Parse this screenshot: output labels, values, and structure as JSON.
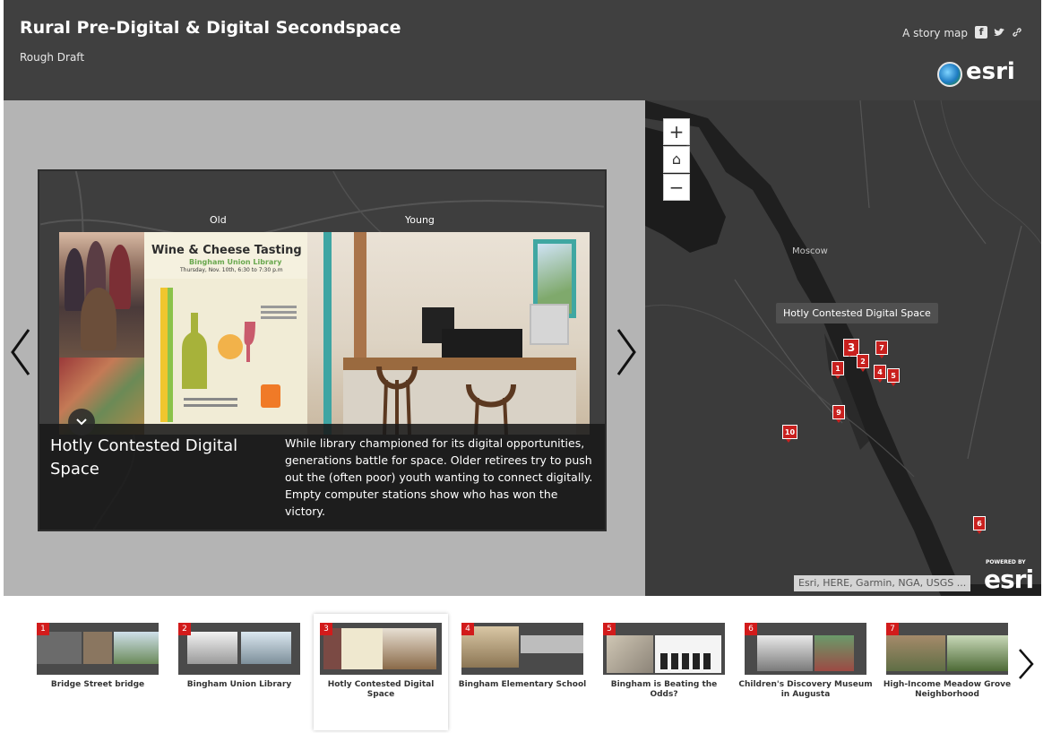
{
  "header": {
    "title": "Rural Pre-Digital & Digital Secondspace",
    "subtitle": "Rough Draft",
    "story_label": "A story map",
    "share_icons": [
      "facebook-icon",
      "twitter-icon",
      "link-icon"
    ],
    "logo_text": "esri",
    "background": "#404040"
  },
  "media": {
    "labels": {
      "old": "Old",
      "young": "Young"
    },
    "poster": {
      "title": "Wine & Cheese Tasting",
      "subtitle": "Bingham Union Library",
      "date": "Thursday, Nov. 10th, 6:30 to 7:30 p.m"
    },
    "caption": {
      "title": "Hotly Contested Digital Space",
      "text": "While library championed for its digital opportunities, generations battle for space. Older retirees try to push out the (often poor) youth wanting to connect digitally. Empty computer stations show who has won the victory."
    }
  },
  "map": {
    "place_label": "Moscow",
    "tooltip": "Hotly Contested Digital Space",
    "zoom_in": "+",
    "home": "⌂",
    "zoom_out": "−",
    "attribution": "Esri, HERE, Garmin, NGA, USGS ...",
    "powered_by": "POWERED BY",
    "powered_logo": "esri",
    "marker_color": "#c8201e",
    "markers": [
      "1",
      "2",
      "3",
      "4",
      "5",
      "6",
      "7",
      "9",
      "10"
    ]
  },
  "carousel": {
    "items": [
      {
        "num": "1",
        "label": "Bridge Street bridge"
      },
      {
        "num": "2",
        "label": "Bingham Union Library"
      },
      {
        "num": "3",
        "label": "Hotly Contested Digital Space",
        "active": true
      },
      {
        "num": "4",
        "label": "Bingham Elementary School"
      },
      {
        "num": "5",
        "label": "Bingham is Beating the Odds?"
      },
      {
        "num": "6",
        "label": "Children's Discovery Museum in Augusta"
      },
      {
        "num": "7",
        "label": "High-Income Meadow Grove Neighborhood"
      }
    ]
  }
}
